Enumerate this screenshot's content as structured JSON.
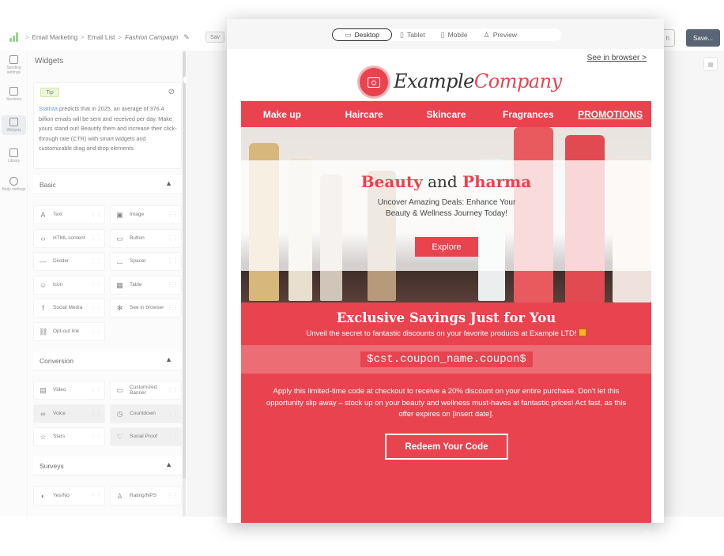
{
  "breadcrumb": {
    "items": [
      "Email Marketing",
      "Email List",
      "Fashion Campaign"
    ],
    "separator": ">"
  },
  "toolbar": {
    "save_chip": "Sav",
    "undo_label": "h",
    "save_label": "Save..."
  },
  "rail": [
    "Sending settings",
    "Sections",
    "Widgets",
    "Library",
    "Body settings"
  ],
  "panel": {
    "title": "Widgets",
    "tip": {
      "badge": "Tip",
      "link": "Statista",
      "text": " predicts that in 2025, an average of 376.4 billion emails will be sent and received per day. Make yours stand out! Beautify them and increase their click-through rate (CTR) with smart widgets and customizable drag and drop elements."
    },
    "sections": {
      "basic": "Basic",
      "conversion": "Conversion",
      "surveys": "Surveys"
    },
    "basic_tiles": [
      "Text",
      "Image",
      "HTML content",
      "Button",
      "Divider",
      "Spacer",
      "Icon",
      "Table",
      "Social Media",
      "See in browser",
      "Opt-out link"
    ],
    "conversion_tiles": [
      "Video",
      "Customized Banner",
      "Voice",
      "Countdown",
      "Stars",
      "Social Proof"
    ],
    "survey_tiles": [
      "Yes/No",
      "Rating/NPS"
    ]
  },
  "devices": [
    "Desktop",
    "Tablet",
    "Mobile",
    "Preview"
  ],
  "email": {
    "browser_link": "See in browser >",
    "logo": {
      "word1": "Example",
      "word2": "Company"
    },
    "nav": [
      "Make up",
      "Haircare",
      "Skincare",
      "Fragrances",
      "PROMOTIONS"
    ],
    "hero": {
      "title_a": "Beauty",
      "title_and": " and ",
      "title_b": "Pharma",
      "subtitle": "Uncover Amazing Deals: Enhance Your Beauty & Wellness Journey Today!",
      "button": "Explore"
    },
    "offer": {
      "title": "Exclusive Savings Just for You",
      "subtitle": "Unveil the secret to fantastic discounts on your favorite products at Example LTD!",
      "coupon": "$cst.coupon_name.coupon$",
      "body": "Apply this limited-time code at checkout to receive a 20% discount on your entire purchase. Don't let this opportunity slip away – stock up on your beauty and wellness must-haves at fantastic prices! Act fast, as this offer expires on [insert date].",
      "button": "Redeem Your Code"
    }
  },
  "colors": {
    "brand": "#e8434f",
    "dark_button": "#2b3a4e",
    "tip_badge": "#e9f8c8"
  }
}
